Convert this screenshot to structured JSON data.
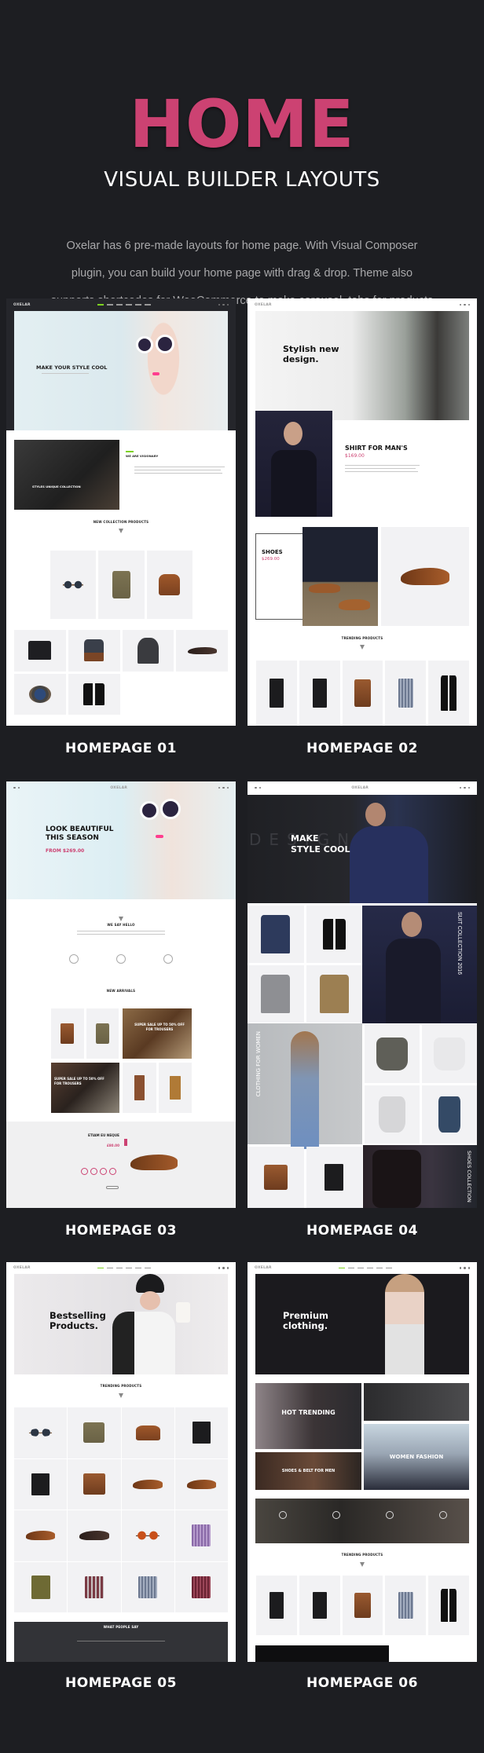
{
  "header": {
    "title": "HOME",
    "subtitle": "VISUAL BUILDER LAYOUTS",
    "description_lines": [
      "Oxelar has 6 pre-made layouts for home page. With Visual Composer",
      "plugin, you can build your home page with drag & drop. Theme also",
      "supports shortcodes for WooCommerce to make carousel, tabs for products"
    ]
  },
  "colors": {
    "background": "#1d1e22",
    "accent": "#cc4272",
    "highlight_green": "#7ed321"
  },
  "logo": "OXELAR",
  "layouts": [
    {
      "label": "HOMEPAGE 01",
      "hero_title": "MAKE YOUR STYLE COOL",
      "about_title": "WE ARE VISIONARY",
      "banner_title": "STYLES UNIQUE COLLECTION",
      "section_title": "NEW COLLECTION PRODUCTS",
      "products": [
        "sunglasses",
        "canvas-bag",
        "duffel-bag"
      ],
      "grid": [
        "jacket",
        "backpack",
        "hoodie",
        "shoes-dark",
        "watch",
        "blazer"
      ]
    },
    {
      "label": "HOMEPAGE 02",
      "hero_title_1": "Stylish new",
      "hero_title_2": "design.",
      "feature_title": "SHIRT FOR MAN'S",
      "feature_price": "$169.00",
      "shoes_title": "SHOES",
      "shoes_price": "$269.00",
      "section_title": "TRENDING PRODUCTS",
      "products": [
        "tote-black",
        "tote-black",
        "leather-bag",
        "shirt-blue",
        "blazer"
      ]
    },
    {
      "label": "HOMEPAGE 03",
      "hero_title_1": "LOOK BEAUTIFUL",
      "hero_title_2": "THIS SEASON",
      "hero_price": "FROM $269.00",
      "hello_title": "WE SAY HELLO",
      "section_title": "NEW ARRIVALS",
      "sale_banner_1": "SUPER SALE UP TO 50% OFF FOR TROUSERS",
      "sale_banner_2": "SUPER SALE UP TO 50% OFF FOR TROUSERS",
      "deal_title": "ETIAM EU NEQUE",
      "deal_price": "£80.00",
      "products_top": [
        "leather-bag",
        "canvas-bag"
      ],
      "products_bottom": [
        "trousers",
        "trousers-tan"
      ]
    },
    {
      "label": "HOMEPAGE 04",
      "hero_title_1": "MAKE",
      "hero_title_2": "STYLE COOL",
      "hero_watermark": "DESIGN",
      "suit_banner": "SUIT COLLECTION 2016",
      "women_banner": "CLOTHING FOR WOMEN",
      "shoes_banner": "SHOES COLLECTION",
      "jackets": [
        "blazer-navy",
        "blazer",
        "blazer-grey",
        "blazer-tan"
      ],
      "tops": [
        "top-grey",
        "top-white",
        "top-light",
        "tank-navy"
      ],
      "bags": [
        "leather-bag",
        "tote-black"
      ]
    },
    {
      "label": "HOMEPAGE 05",
      "hero_title_1": "Bestselling",
      "hero_title_2": "Products.",
      "section_title": "TRENDING PRODUCTS",
      "testimonial_title": "WHAT PEOPLE SAY",
      "products": [
        "sunglasses",
        "canvas-bag",
        "duffel-bag",
        "tote-black",
        "tote-black",
        "leather-bag",
        "shoes-brown",
        "shoes-brown",
        "shoes-brown",
        "shoes-dark",
        "sunglasses-orange",
        "shirt-purple",
        "shirt-olive",
        "shirt-plaid",
        "shirt-blue",
        "shirt-red"
      ]
    },
    {
      "label": "HOMEPAGE 06",
      "hero_title_1": "Premium",
      "hero_title_2": "clothing.",
      "banner_1": "HOT TRENDING",
      "banner_2": "SHOES & BELT FOR MEN",
      "banner_3": "WOMEN FASHION",
      "section_title": "TRENDING PRODUCTS",
      "products": [
        "tote-black",
        "tote-black",
        "leather-bag",
        "shirt-blue",
        "blazer"
      ]
    }
  ]
}
